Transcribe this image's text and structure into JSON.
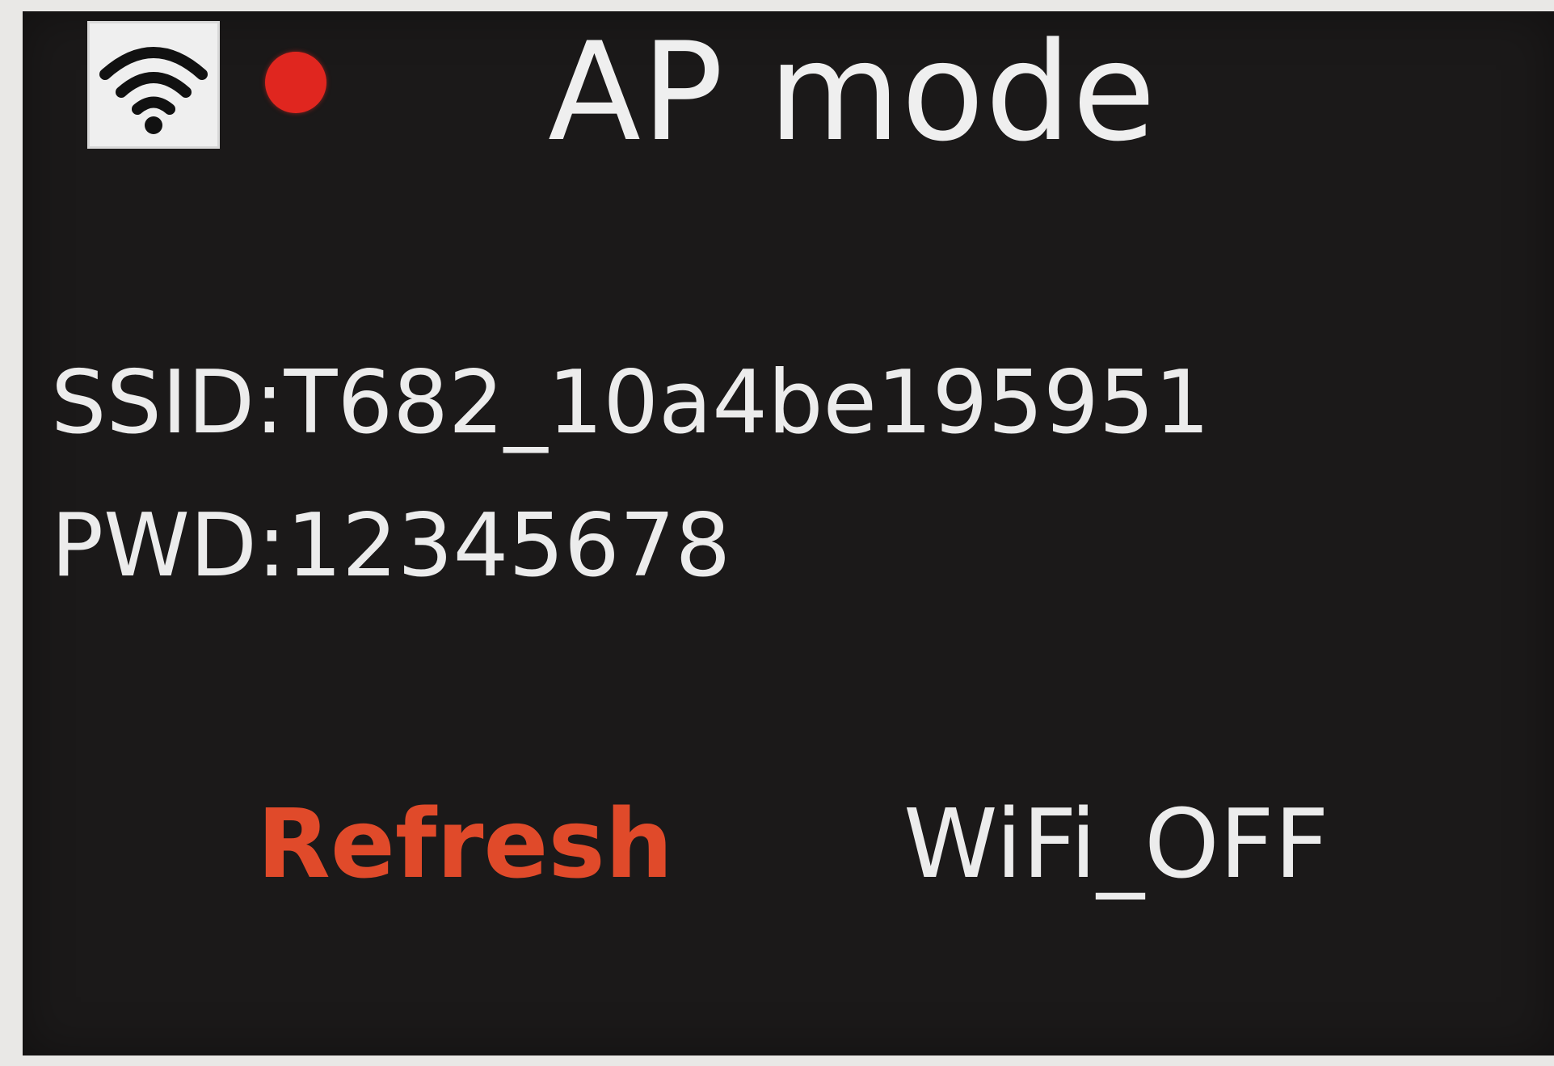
{
  "header": {
    "title": "AP mode",
    "wifi_icon": "wifi-icon",
    "status_dot_color": "#e0261f"
  },
  "network": {
    "ssid_text": "SSID:T682_10a4be195951",
    "pwd_text": "PWD:12345678"
  },
  "actions": {
    "refresh_label": "Refresh",
    "refresh_color": "#e04a2a",
    "wifi_off_label": "WiFi_OFF"
  },
  "colors": {
    "screen_background": "#1b1919",
    "text": "#ececec"
  }
}
